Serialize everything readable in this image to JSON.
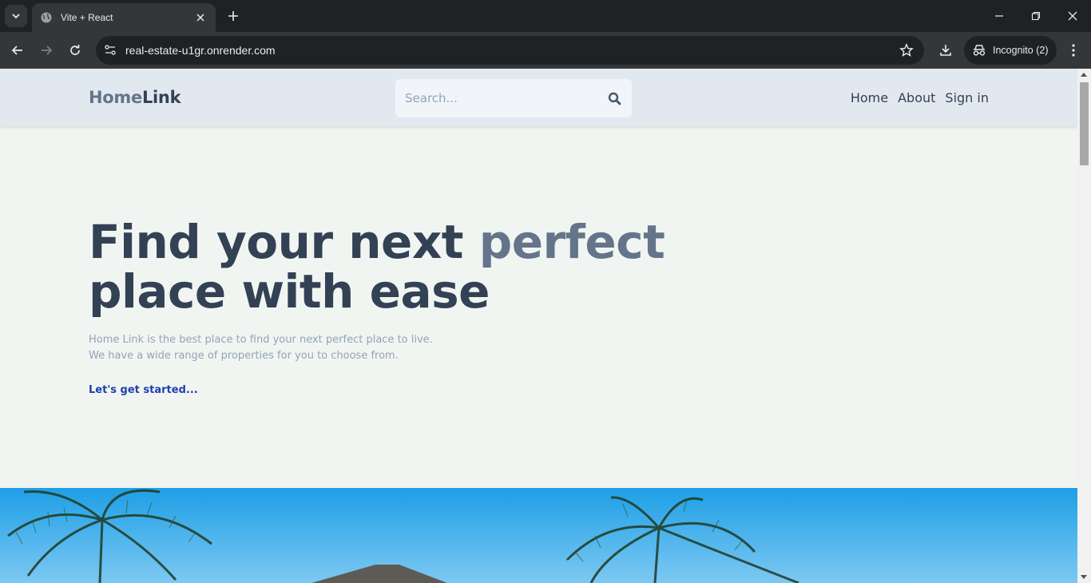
{
  "browser": {
    "tab_title": "Vite + React",
    "url": "real-estate-u1gr.onrender.com",
    "incognito_label": "Incognito (2)"
  },
  "site": {
    "logo_part1": "Home",
    "logo_part2": "Link",
    "search_placeholder": "Search...",
    "nav": [
      "Home",
      "About",
      "Sign in"
    ]
  },
  "hero": {
    "title_line1_a": "Find your next ",
    "title_line1_b": "perfect",
    "title_line2": "place with ease",
    "description_line1": "Home Link is the best place to find your next perfect place to live.",
    "description_line2": "We have a wide range of properties for you to choose from.",
    "cta": "Let's get started..."
  },
  "icons": [
    "tab-search-icon",
    "globe-icon",
    "close-icon",
    "plus-icon",
    "minimize-icon",
    "restore-icon",
    "back-icon",
    "forward-icon",
    "reload-icon",
    "site-info-icon",
    "star-icon",
    "download-icon",
    "incognito-icon",
    "more-vert-icon",
    "search-icon"
  ],
  "colors": {
    "header_bg": "#e2e8f0",
    "page_bg": "#f1f5f1",
    "title": "#334155",
    "accent": "#64748b",
    "cta": "#1e40af",
    "sky": "#29a8e8"
  }
}
